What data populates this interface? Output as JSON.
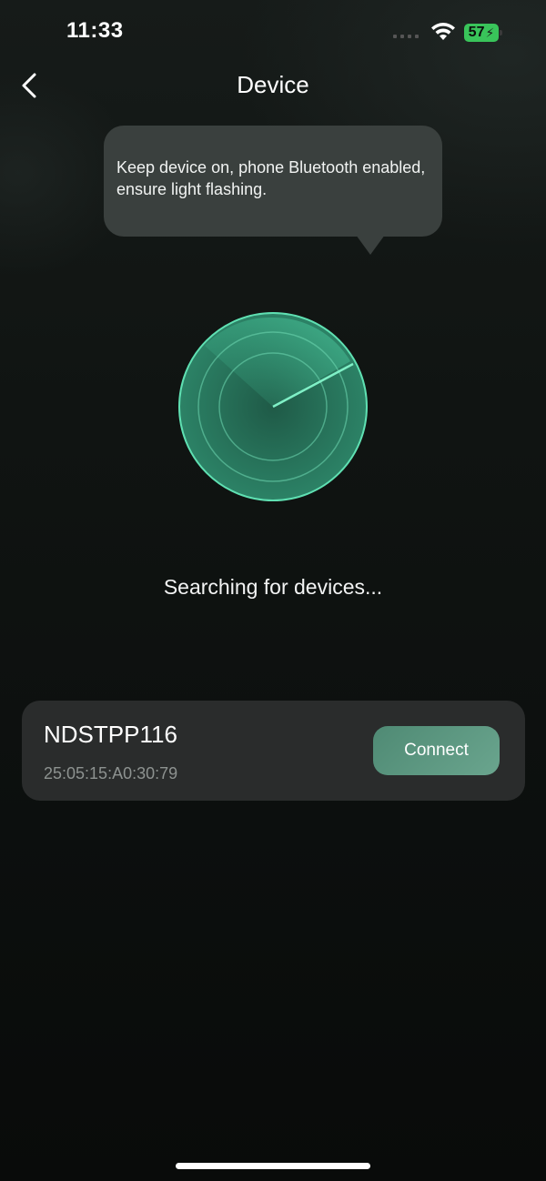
{
  "status_bar": {
    "time": "11:33",
    "battery_percent": "57"
  },
  "header": {
    "title": "Device",
    "back_icon": "chevron-left-icon"
  },
  "tip": {
    "text": "Keep device on, phone Bluetooth enabled, ensure light flashing."
  },
  "scanner": {
    "status_text": "Searching for devices...",
    "accent_color": "#4fd6a4"
  },
  "device": {
    "name": "NDSTPP116",
    "mac": "25:05:15:A0:30:79",
    "connect_label": "Connect",
    "button_color": "#5b957f"
  }
}
